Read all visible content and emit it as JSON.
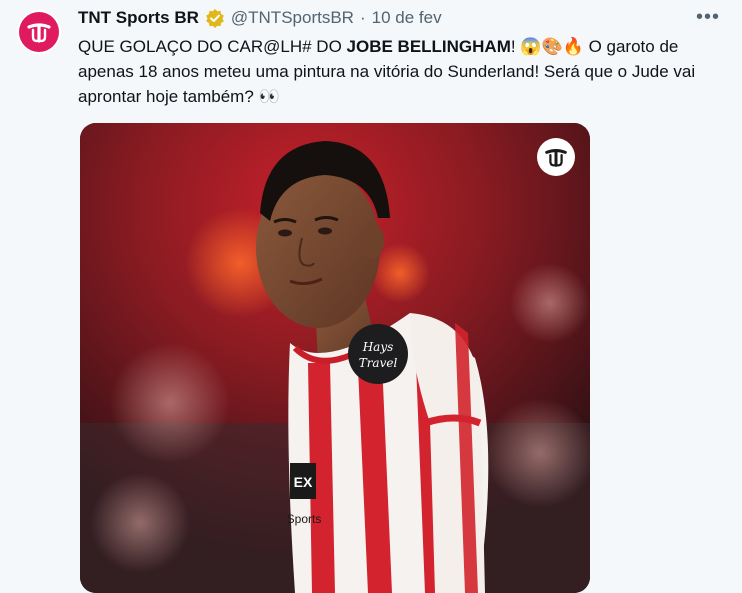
{
  "tweet": {
    "author_name": "TNT Sports BR",
    "handle": "@TNTSportsBR",
    "separator": "·",
    "date": "10 de fev",
    "more_label": "•••",
    "text_part1": "QUE GOLAÇO DO CAR@LH# DO ",
    "text_bold": "JOBE BELLINGHAM",
    "text_part2": "! ",
    "emojis_1": "😱🎨🔥",
    "text_part3": " O garoto de apenas 18 anos meteu uma pintura na vitória do Sunderland! Será que o Jude vai aprontar hoje também? ",
    "emojis_2": "👀",
    "media": {
      "sponsor_text_1": "Hays",
      "sponsor_text_2": "Travel",
      "shirt_text_1": "EX",
      "shirt_text_2": "Sports"
    }
  },
  "colors": {
    "brand": "#e01a5f",
    "background": "#f5f8fa",
    "text": "#0f1419",
    "muted": "#536471",
    "verified": "#e2b719"
  }
}
